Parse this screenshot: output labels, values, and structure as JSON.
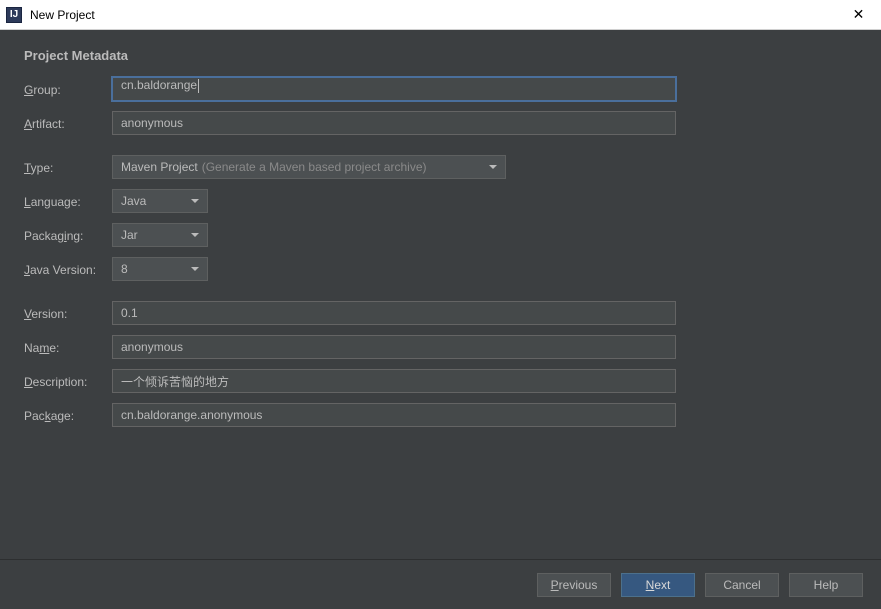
{
  "window": {
    "title": "New Project",
    "close_glyph": "✕"
  },
  "section": {
    "title": "Project Metadata"
  },
  "labels": {
    "group_u": "G",
    "group_r": "roup:",
    "artifact_u": "A",
    "artifact_r": "rtifact:",
    "type_u": "T",
    "type_r": "ype:",
    "language_u": "L",
    "language_r": "anguage:",
    "packaging_r1": "Packag",
    "packaging_u": "i",
    "packaging_r2": "ng:",
    "javaver_u": "J",
    "javaver_r": "ava Version:",
    "version_u": "V",
    "version_r": "ersion:",
    "name_r1": "Na",
    "name_u": "m",
    "name_r2": "e:",
    "description_u": "D",
    "description_r": "escription:",
    "package_r1": "Pac",
    "package_u": "k",
    "package_r2": "age:"
  },
  "fields": {
    "group": "cn.baldorange",
    "artifact": "anonymous",
    "type_value": "Maven Project",
    "type_hint": "(Generate a Maven based project archive)",
    "language": "Java",
    "packaging": "Jar",
    "java_version": "8",
    "version": "0.1",
    "name": "anonymous",
    "description": "一个倾诉苦恼的地方",
    "package": "cn.baldorange.anonymous"
  },
  "buttons": {
    "previous_u": "P",
    "previous_r": "revious",
    "next_u": "N",
    "next_r": "ext",
    "cancel": "Cancel",
    "help": "Help"
  }
}
